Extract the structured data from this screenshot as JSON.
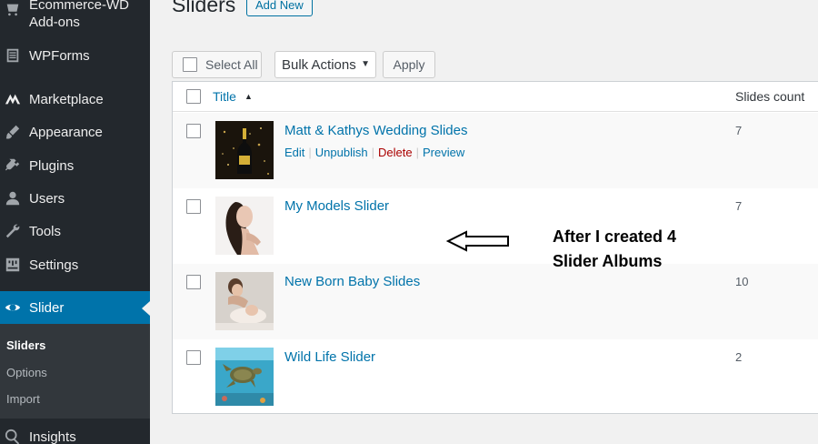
{
  "sidebar": {
    "items": [
      {
        "label": "Ecommerce-WD Add-ons",
        "icon": "ecommerce-icon"
      },
      {
        "label": "WPForms",
        "icon": "form-icon"
      },
      {
        "label": "Marketplace",
        "icon": "marketplace-icon"
      },
      {
        "label": "Appearance",
        "icon": "brush-icon"
      },
      {
        "label": "Plugins",
        "icon": "plug-icon"
      },
      {
        "label": "Users",
        "icon": "user-icon"
      },
      {
        "label": "Tools",
        "icon": "wrench-icon"
      },
      {
        "label": "Settings",
        "icon": "settings-icon"
      },
      {
        "label": "Slider",
        "icon": "slider-icon",
        "active": true
      },
      {
        "label": "Insights",
        "icon": "insights-icon"
      }
    ],
    "submenu": [
      {
        "label": "Sliders",
        "current": true
      },
      {
        "label": "Options"
      },
      {
        "label": "Import"
      }
    ],
    "colors": {
      "background": "#23282d",
      "active": "#0073aa",
      "submenu": "#32373c"
    }
  },
  "header": {
    "title": "Sliders",
    "add_new_label": "Add New"
  },
  "toolbar": {
    "select_all_label": "Select All",
    "bulk_actions_label": "Bulk Actions",
    "apply_label": "Apply"
  },
  "table": {
    "columns": {
      "title": "Title",
      "count": "Slides count"
    },
    "rows": [
      {
        "title": "Matt & Kathys Wedding Slides",
        "count": "7",
        "actions": {
          "edit": "Edit",
          "unpublish": "Unpublish",
          "delete": "Delete",
          "preview": "Preview"
        }
      },
      {
        "title": "My Models Slider",
        "count": "7"
      },
      {
        "title": "New Born Baby Slides",
        "count": "10"
      },
      {
        "title": "Wild Life Slider",
        "count": "2"
      }
    ]
  },
  "annotation": {
    "line1": "After I created 4",
    "line2": "Slider Albums"
  },
  "colors": {
    "link": "#0073aa",
    "delete": "#aa0000"
  }
}
